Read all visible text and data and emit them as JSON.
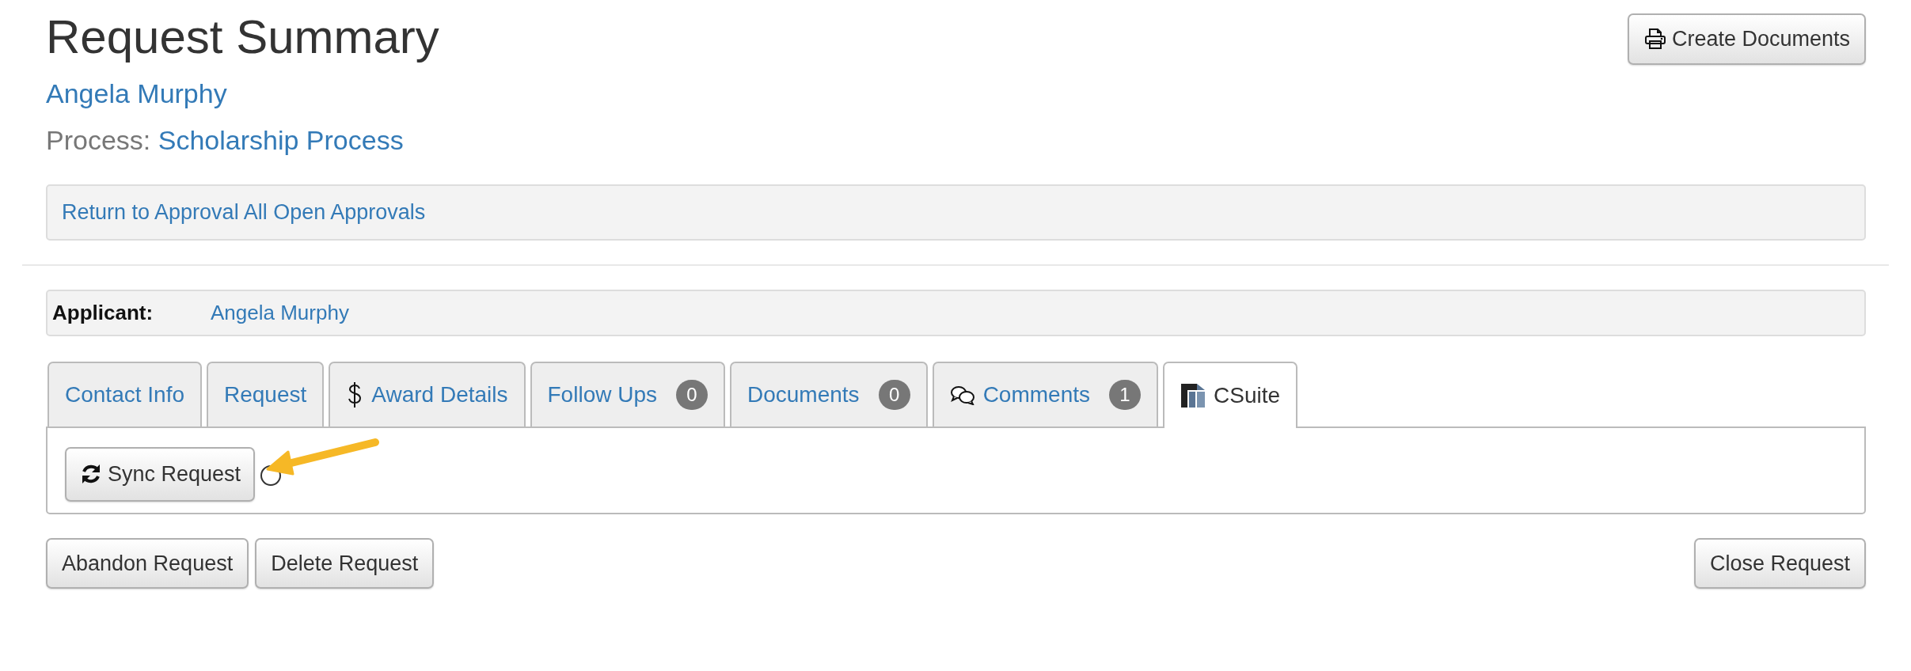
{
  "header": {
    "title": "Request Summary",
    "create_button": "Create Documents",
    "person": "Angela Murphy",
    "process_label": "Process:",
    "process_name": "Scholarship Process"
  },
  "breadcrumb_link": "Return to Approval All Open Approvals",
  "applicant": {
    "label": "Applicant:",
    "name": "Angela Murphy"
  },
  "tabs": [
    {
      "label": "Contact Info",
      "kind": "plain",
      "selected": false
    },
    {
      "label": "Request",
      "kind": "plain",
      "selected": false
    },
    {
      "label": "Award Details",
      "kind": "dollar",
      "selected": false
    },
    {
      "label": "Follow Ups",
      "kind": "plain",
      "count": "0",
      "selected": false
    },
    {
      "label": "Documents",
      "kind": "plain",
      "count": "0",
      "selected": false
    },
    {
      "label": "Comments",
      "kind": "chat",
      "count": "1",
      "selected": false
    },
    {
      "label": "CSuite",
      "kind": "logo",
      "selected": true
    }
  ],
  "tab_panel": {
    "sync_button": "Sync Request"
  },
  "footer_left_buttons": [
    "Abandon Request",
    "Delete Request"
  ],
  "footer_right_buttons": [
    "Close Request"
  ]
}
